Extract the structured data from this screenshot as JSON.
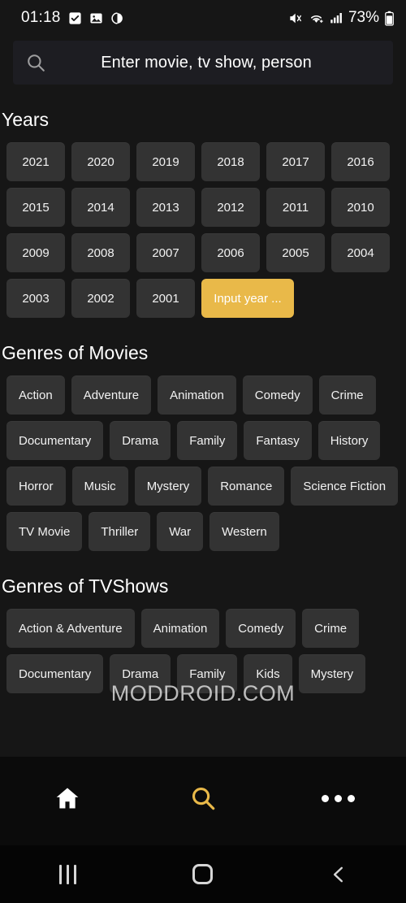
{
  "statusbar": {
    "time": "01:18",
    "battery_percent": "73%",
    "icons": [
      "checkbox-checked-icon",
      "photo-icon",
      "dnd-icon",
      "mute-vibrate-icon",
      "wifi-icon",
      "cellular-signal-icon",
      "battery-icon"
    ]
  },
  "search": {
    "placeholder": "Enter movie, tv show, person",
    "icon": "search-icon"
  },
  "years_section": {
    "title": "Years",
    "years": [
      "2021",
      "2020",
      "2019",
      "2018",
      "2017",
      "2016",
      "2015",
      "2014",
      "2013",
      "2012",
      "2011",
      "2010",
      "2009",
      "2008",
      "2007",
      "2006",
      "2005",
      "2004",
      "2003",
      "2002",
      "2001"
    ],
    "input_year_label": "Input year ..."
  },
  "movie_genres_section": {
    "title": "Genres of Movies",
    "genres": [
      "Action",
      "Adventure",
      "Animation",
      "Comedy",
      "Crime",
      "Documentary",
      "Drama",
      "Family",
      "Fantasy",
      "History",
      "Horror",
      "Music",
      "Mystery",
      "Romance",
      "Science Fiction",
      "TV Movie",
      "Thriller",
      "War",
      "Western"
    ]
  },
  "tv_genres_section": {
    "title": "Genres of TVShows",
    "genres": [
      "Action & Adventure",
      "Animation",
      "Comedy",
      "Crime",
      "Documentary",
      "Drama",
      "Family",
      "Kids",
      "Mystery"
    ]
  },
  "watermark": {
    "text": "MODDROID.COM"
  },
  "bottom_nav": {
    "items": [
      {
        "name": "home",
        "icon": "home-icon",
        "active": false
      },
      {
        "name": "search",
        "icon": "search-icon",
        "active": true
      },
      {
        "name": "more",
        "icon": "more-horizontal-icon",
        "active": false
      }
    ]
  },
  "system_nav": {
    "items": [
      {
        "name": "recents",
        "icon": "recents-icon"
      },
      {
        "name": "home",
        "icon": "home-square-icon"
      },
      {
        "name": "back",
        "icon": "back-chevron-icon"
      }
    ]
  },
  "colors": {
    "background": "#161616",
    "chip": "#333333",
    "accent": "#e9b949",
    "searchbar": "#1d1d22",
    "nav_background": "#0b0b0b"
  }
}
